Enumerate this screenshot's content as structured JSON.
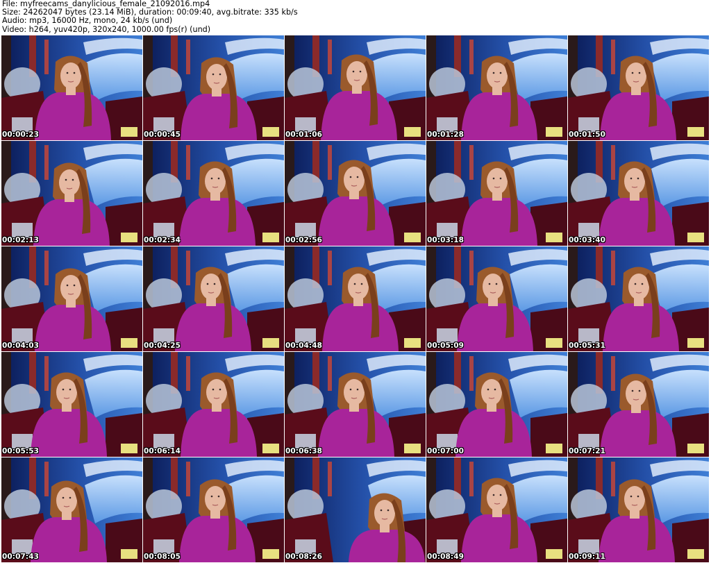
{
  "header": {
    "file_line": "File: myfreecams_danylicious_female_21092016.mp4",
    "size_line": "Size: 24262047 bytes (23.14 MiB), duration: 00:09:40, avg.bitrate: 335 kb/s",
    "audio_line": "Audio: mp3, 16000 Hz, mono, 24 kb/s (und)",
    "video_line": "Video: h264, yuv420p, 320x240, 1000.00 fps(r) (und)"
  },
  "frames": [
    {
      "time": "00:00:23"
    },
    {
      "time": "00:00:45"
    },
    {
      "time": "00:01:06"
    },
    {
      "time": "00:01:28"
    },
    {
      "time": "00:01:50"
    },
    {
      "time": "00:02:13"
    },
    {
      "time": "00:02:34"
    },
    {
      "time": "00:02:56"
    },
    {
      "time": "00:03:18"
    },
    {
      "time": "00:03:40"
    },
    {
      "time": "00:04:03"
    },
    {
      "time": "00:04:25"
    },
    {
      "time": "00:04:48"
    },
    {
      "time": "00:05:09"
    },
    {
      "time": "00:05:31"
    },
    {
      "time": "00:05:53"
    },
    {
      "time": "00:06:14"
    },
    {
      "time": "00:06:38"
    },
    {
      "time": "00:07:00"
    },
    {
      "time": "00:07:21"
    },
    {
      "time": "00:07:43"
    },
    {
      "time": "00:08:05"
    },
    {
      "time": "00:08:26"
    },
    {
      "time": "00:08:49"
    },
    {
      "time": "00:09:11"
    }
  ],
  "colors": {
    "shirt": "#a8249a",
    "hair": "#9a5a2c",
    "skin": "#e6b9a2",
    "wall_blue": "#2b5bb0",
    "couch_red": "#5a0c1a"
  }
}
